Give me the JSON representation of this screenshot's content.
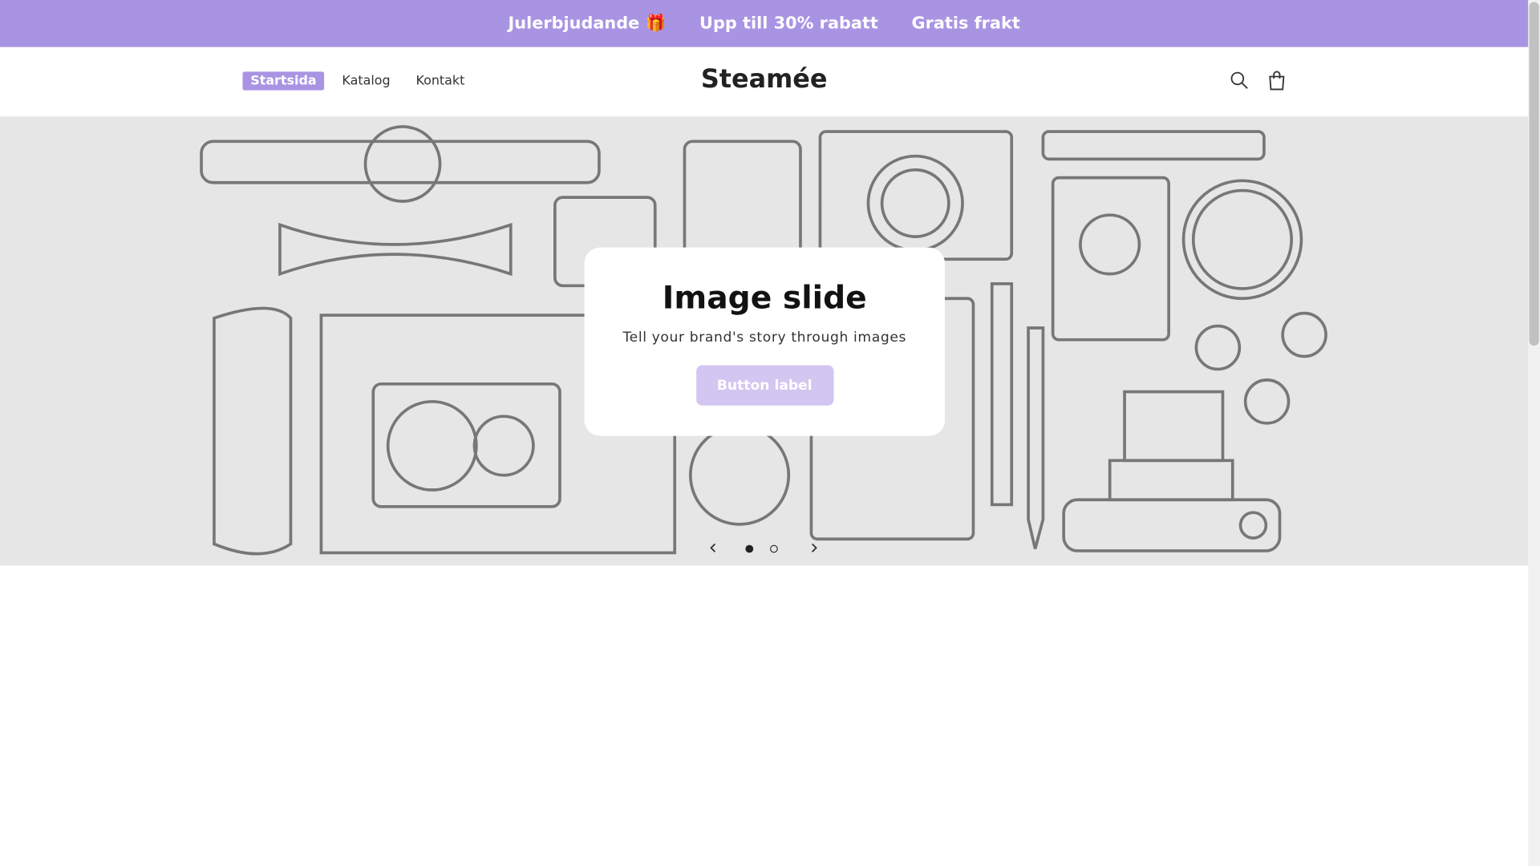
{
  "announcement": {
    "items": [
      "Julerbjudande 🎁",
      "Upp till 30% rabatt",
      "Gratis frakt"
    ]
  },
  "header": {
    "logo": "Steamée",
    "nav": [
      {
        "label": "Startsida",
        "active": true
      },
      {
        "label": "Katalog"
      },
      {
        "label": "Kontakt"
      }
    ],
    "icons": [
      "search-icon",
      "cart-icon"
    ]
  },
  "slide": {
    "title": "Image slide",
    "text": "Tell your brand's story through images",
    "button": "Button label",
    "current": 1,
    "total": 2
  },
  "colors": {
    "accent": "#a994e3",
    "button": "#d3c6f0",
    "hero_bg": "#e6e6e6"
  }
}
